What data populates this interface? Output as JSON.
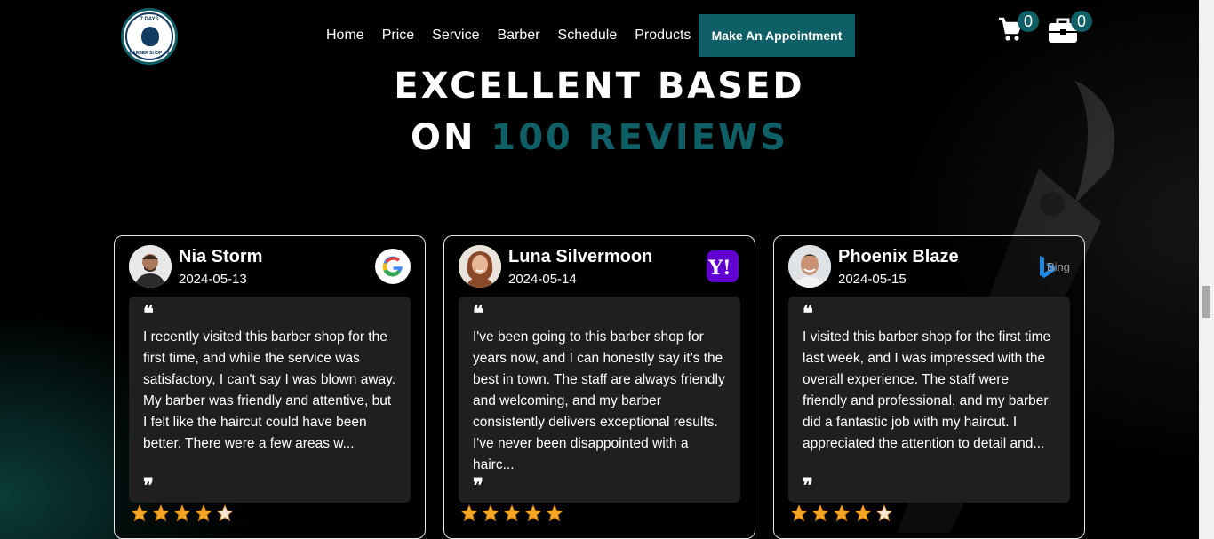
{
  "header": {
    "logo": {
      "top": "7 DAYS",
      "bottom": "BARBER SHOP US"
    },
    "nav": [
      "Home",
      "Price",
      "Service",
      "Barber",
      "Schedule",
      "Products"
    ],
    "cta_label": "Make An Appointment",
    "cart_count": "0",
    "bag_count": "0",
    "icons": {
      "cart": "cart-icon",
      "bag": "briefcase-icon"
    }
  },
  "heading": {
    "line1": "EXCELLENT BASED",
    "line2_prefix": "ON",
    "line2_highlight": "100 REVIEWS"
  },
  "colors": {
    "accent": "#0f5f66",
    "star": "#f5a623",
    "star_empty": "#f5e6d0"
  },
  "reviews": [
    {
      "name": "Nia Storm",
      "date": "2024-05-13",
      "source": "google",
      "text": "I recently visited this barber shop for the first time, and while the service was satisfactory, I can't say I was blown away. My barber was friendly and attentive, but I felt like the haircut could have been better. There were a few areas w...",
      "rating": 4
    },
    {
      "name": "Luna Silvermoon",
      "date": "2024-05-14",
      "source": "yahoo",
      "source_label": "Y!",
      "text": "I've been going to this barber shop for years now, and I can honestly say it's the best in town. The staff are always friendly and welcoming, and my barber consistently delivers exceptional results. I've never been disappointed with a hairc...",
      "rating": 5
    },
    {
      "name": "Phoenix Blaze",
      "date": "2024-05-15",
      "source": "bing",
      "source_label": "Bing",
      "text": "I visited this barber shop for the first time last week, and I was impressed with the overall experience. The staff were friendly and professional, and my barber did a fantastic job with my haircut. I appreciated the attention to detail and...",
      "rating": 4
    }
  ]
}
